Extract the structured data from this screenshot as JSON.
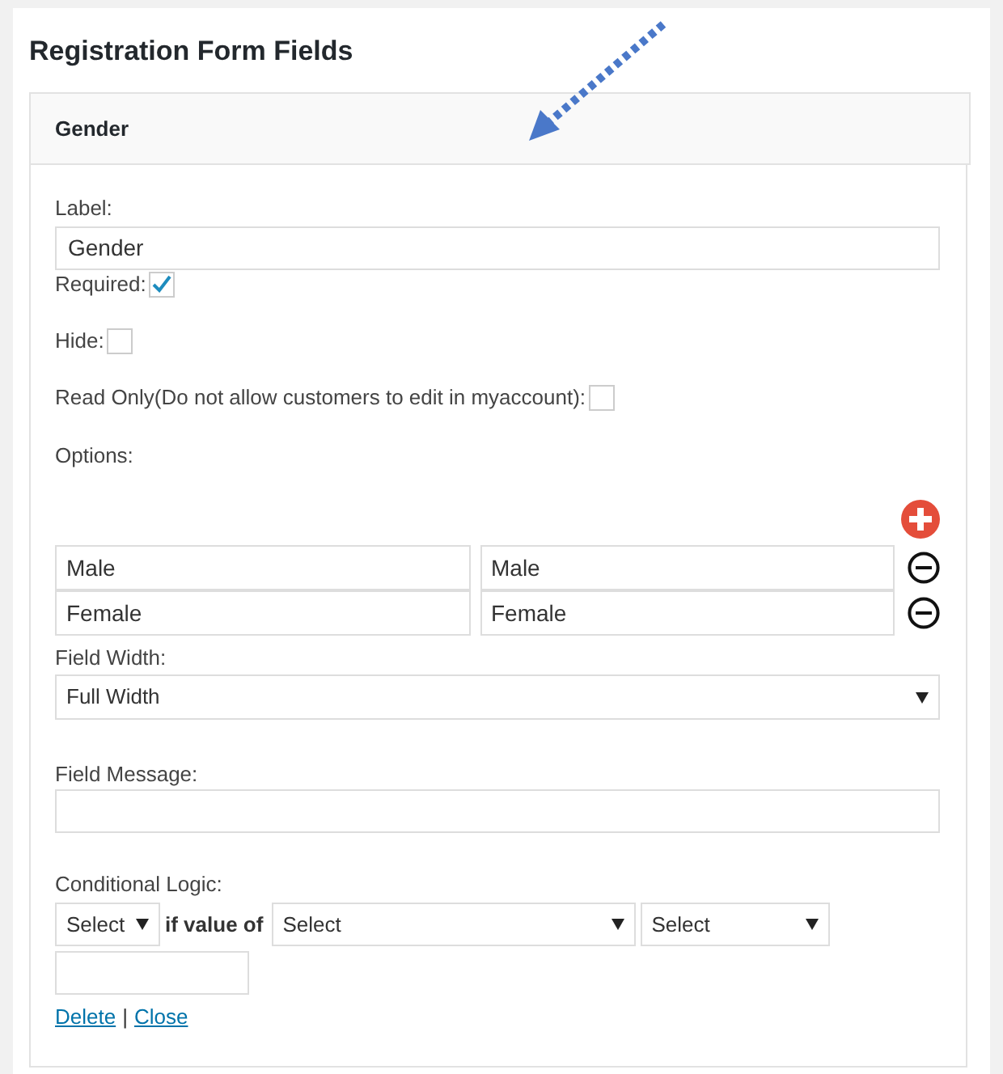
{
  "title": "Registration Form Fields",
  "field": {
    "header": "Gender",
    "label_field": {
      "label": "Label:",
      "value": "Gender"
    },
    "checkboxes": [
      {
        "label": "Required:",
        "checked": true
      },
      {
        "label": "Hide:",
        "checked": false
      },
      {
        "label": "Read Only(Do not allow customers to edit in myaccount):",
        "checked": false
      }
    ],
    "options_label": "Options:",
    "options": [
      {
        "label": "Male",
        "value": "Male"
      },
      {
        "label": "Female",
        "value": "Female"
      }
    ],
    "field_width": {
      "label": "Field Width:",
      "value": "Full Width"
    },
    "field_message": {
      "label": "Field Message:"
    },
    "conditional_logic": {
      "label": "Conditional Logic:",
      "action": "Select",
      "connector": "if value of",
      "field": "Select",
      "operator": "Select"
    },
    "links": [
      "Delete",
      "Close"
    ],
    "link_separator": "|"
  }
}
